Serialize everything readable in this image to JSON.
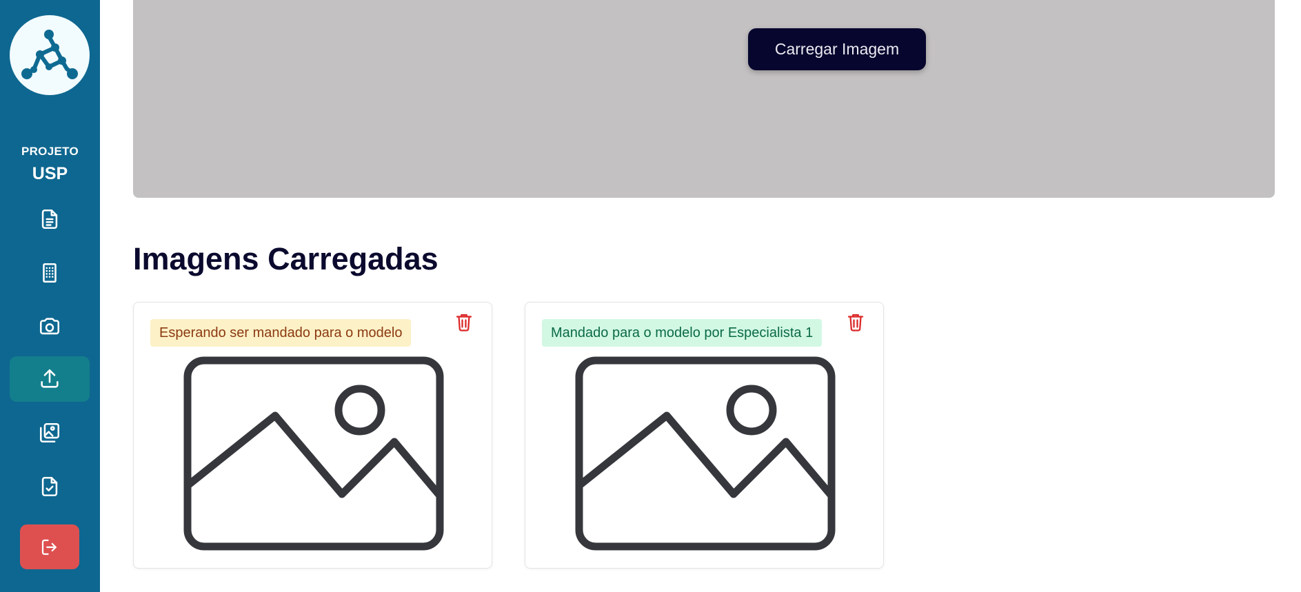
{
  "sidebar": {
    "logo_icon": "molecule-network-icon",
    "brand_small": "PROJETO",
    "brand_big": "USP",
    "items": [
      {
        "icon": "document-icon"
      },
      {
        "icon": "building-icon"
      },
      {
        "icon": "camera-icon"
      },
      {
        "icon": "upload-icon",
        "active": true
      },
      {
        "icon": "image-gallery-icon"
      },
      {
        "icon": "file-check-icon"
      }
    ],
    "logout_icon": "logout-icon"
  },
  "upload": {
    "button_label": "Carregar Imagem"
  },
  "section": {
    "title": "Imagens Carregadas"
  },
  "cards": [
    {
      "status": "Esperando ser mandado para o modelo",
      "status_type": "waiting"
    },
    {
      "status": "Mandado para o modelo por Especialista 1",
      "status_type": "sent"
    }
  ],
  "colors": {
    "sidebar": "#0e6790",
    "active_nav": "#147f8c",
    "logout": "#de5050",
    "upload_area": "#c4c1c3",
    "button": "#07062e",
    "title": "#0b0a2e",
    "delete": "#dc2626"
  }
}
